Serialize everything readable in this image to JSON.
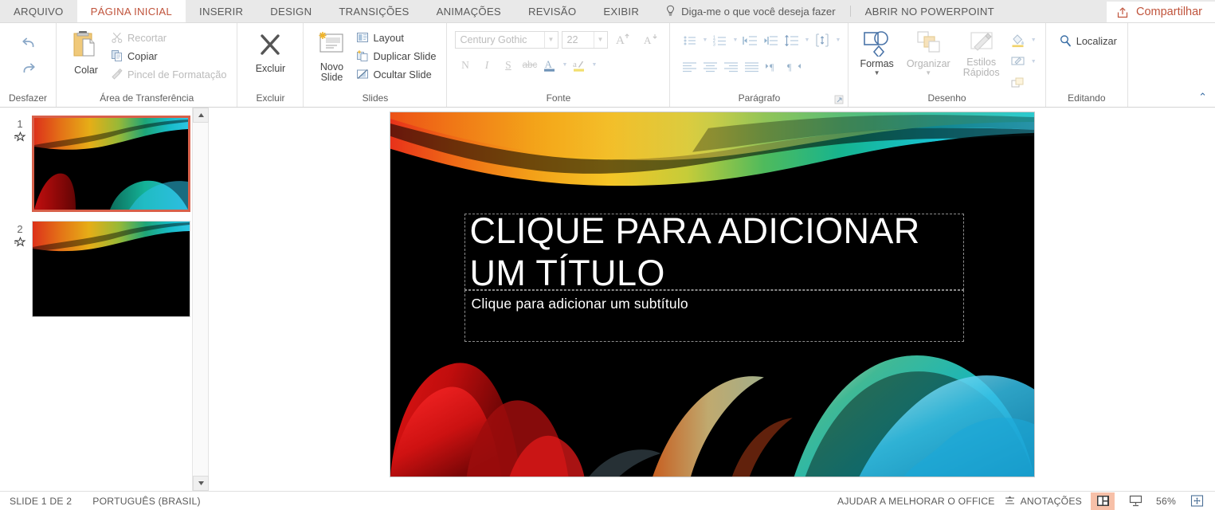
{
  "menubar": {
    "tabs": [
      {
        "label": "ARQUIVO",
        "active": false
      },
      {
        "label": "PÁGINA INICIAL",
        "active": true
      },
      {
        "label": "INSERIR",
        "active": false
      },
      {
        "label": "DESIGN",
        "active": false
      },
      {
        "label": "TRANSIÇÕES",
        "active": false
      },
      {
        "label": "ANIMAÇÕES",
        "active": false
      },
      {
        "label": "REVISÃO",
        "active": false
      },
      {
        "label": "EXIBIR",
        "active": false
      }
    ],
    "tell_me": "Diga-me o que você deseja fazer",
    "open_in_powerpoint": "ABRIR NO POWERPOINT",
    "share": "Compartilhar",
    "accent_color": "#c0543c"
  },
  "ribbon": {
    "undo": {
      "group_label": "Desfazer",
      "undo_name": "Desfazer",
      "redo_name": "Refazer"
    },
    "clipboard": {
      "group_label": "Área de Transferência",
      "paste": "Colar",
      "cut": "Recortar",
      "copy": "Copiar",
      "format_painter": "Pincel de Formatação"
    },
    "delete": {
      "group_label": "Excluir",
      "button": "Excluir"
    },
    "slides": {
      "group_label": "Slides",
      "new_slide_line1": "Novo",
      "new_slide_line2": "Slide",
      "layout": "Layout",
      "duplicate": "Duplicar Slide",
      "hide": "Ocultar Slide"
    },
    "font": {
      "group_label": "Fonte",
      "font_family": "Century Gothic",
      "font_size": "22",
      "bold": "N",
      "italic": "I",
      "underline": "S",
      "strikethrough": "abc",
      "font_color": "A",
      "highlight": "ab"
    },
    "paragraph": {
      "group_label": "Parágrafo"
    },
    "drawing": {
      "group_label": "Desenho",
      "shapes": "Formas",
      "arrange": "Organizar",
      "quick_styles_line1": "Estilos",
      "quick_styles_line2": "Rápidos"
    },
    "editing": {
      "group_label": "Editando",
      "find": "Localizar"
    }
  },
  "thumbnails": [
    {
      "number": "1",
      "selected": true
    },
    {
      "number": "2",
      "selected": false
    }
  ],
  "slide": {
    "title_placeholder": "CLIQUE PARA ADICIONAR UM TÍTULO",
    "subtitle_placeholder": "Clique para adicionar um subtítulo"
  },
  "status": {
    "slide_count": "SLIDE 1 DE 2",
    "language": "PORTUGUÊS (BRASIL)",
    "improve_office": "AJUDAR A MELHORAR O OFFICE",
    "notes": "ANOTAÇÕES",
    "zoom": "56%"
  }
}
